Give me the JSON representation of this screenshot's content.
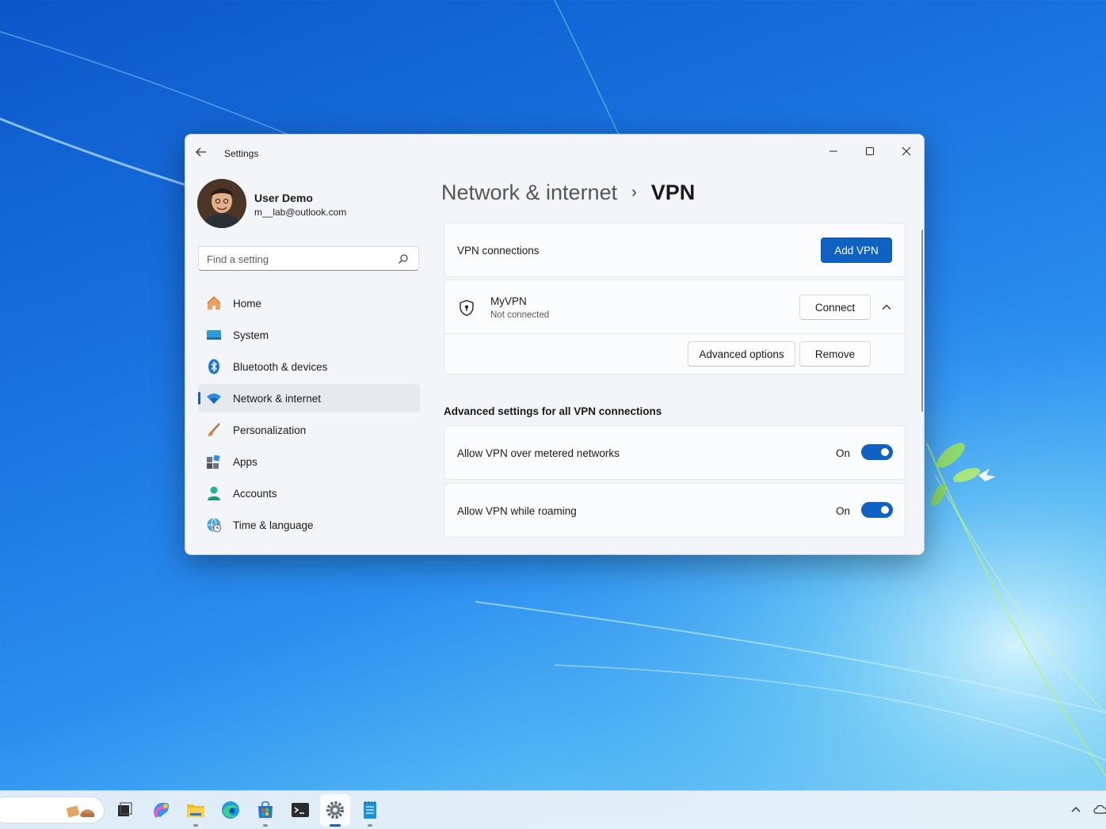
{
  "window": {
    "app_title": "Settings",
    "back_icon": "back-arrow-icon",
    "controls": [
      "minimize-icon",
      "maximize-icon",
      "close-icon"
    ]
  },
  "profile": {
    "name": "User Demo",
    "email": "m__lab@outlook.com"
  },
  "search": {
    "placeholder": "Find a setting",
    "icon": "search-icon"
  },
  "sidebar": {
    "items": [
      {
        "label": "Home",
        "icon": "home-icon",
        "active": false
      },
      {
        "label": "System",
        "icon": "system-icon",
        "active": false
      },
      {
        "label": "Bluetooth & devices",
        "icon": "bluetooth-icon",
        "active": false
      },
      {
        "label": "Network & internet",
        "icon": "wifi-icon",
        "active": true
      },
      {
        "label": "Personalization",
        "icon": "brush-icon",
        "active": false
      },
      {
        "label": "Apps",
        "icon": "apps-icon",
        "active": false
      },
      {
        "label": "Accounts",
        "icon": "accounts-icon",
        "active": false
      },
      {
        "label": "Time & language",
        "icon": "globe-clock-icon",
        "active": false
      }
    ]
  },
  "breadcrumb": {
    "parent": "Network & internet",
    "separator": "›",
    "current": "VPN"
  },
  "vpn_connections": {
    "label": "VPN connections",
    "add_button": "Add VPN"
  },
  "vpn_entry": {
    "name": "MyVPN",
    "status": "Not connected",
    "connect_button": "Connect",
    "advanced_button": "Advanced options",
    "remove_button": "Remove",
    "expanded": true
  },
  "advanced_section": {
    "title": "Advanced settings for all VPN connections",
    "settings": [
      {
        "label": "Allow VPN over metered networks",
        "state_text": "On",
        "on": true
      },
      {
        "label": "Allow VPN while roaming",
        "state_text": "On",
        "on": true
      }
    ]
  },
  "taskbar": {
    "apps": [
      "widgets-icon",
      "task-view-icon",
      "copilot-icon",
      "file-explorer-icon",
      "edge-icon",
      "store-icon",
      "terminal-icon",
      "settings-icon",
      "notepad-icon"
    ],
    "active_app": "settings-icon",
    "tray": [
      "chevron-up-icon",
      "onedrive-icon"
    ]
  },
  "colors": {
    "accent": "#0f62c2",
    "window_bg": "#f3f5f8",
    "card_bg": "#fbfcfd"
  }
}
